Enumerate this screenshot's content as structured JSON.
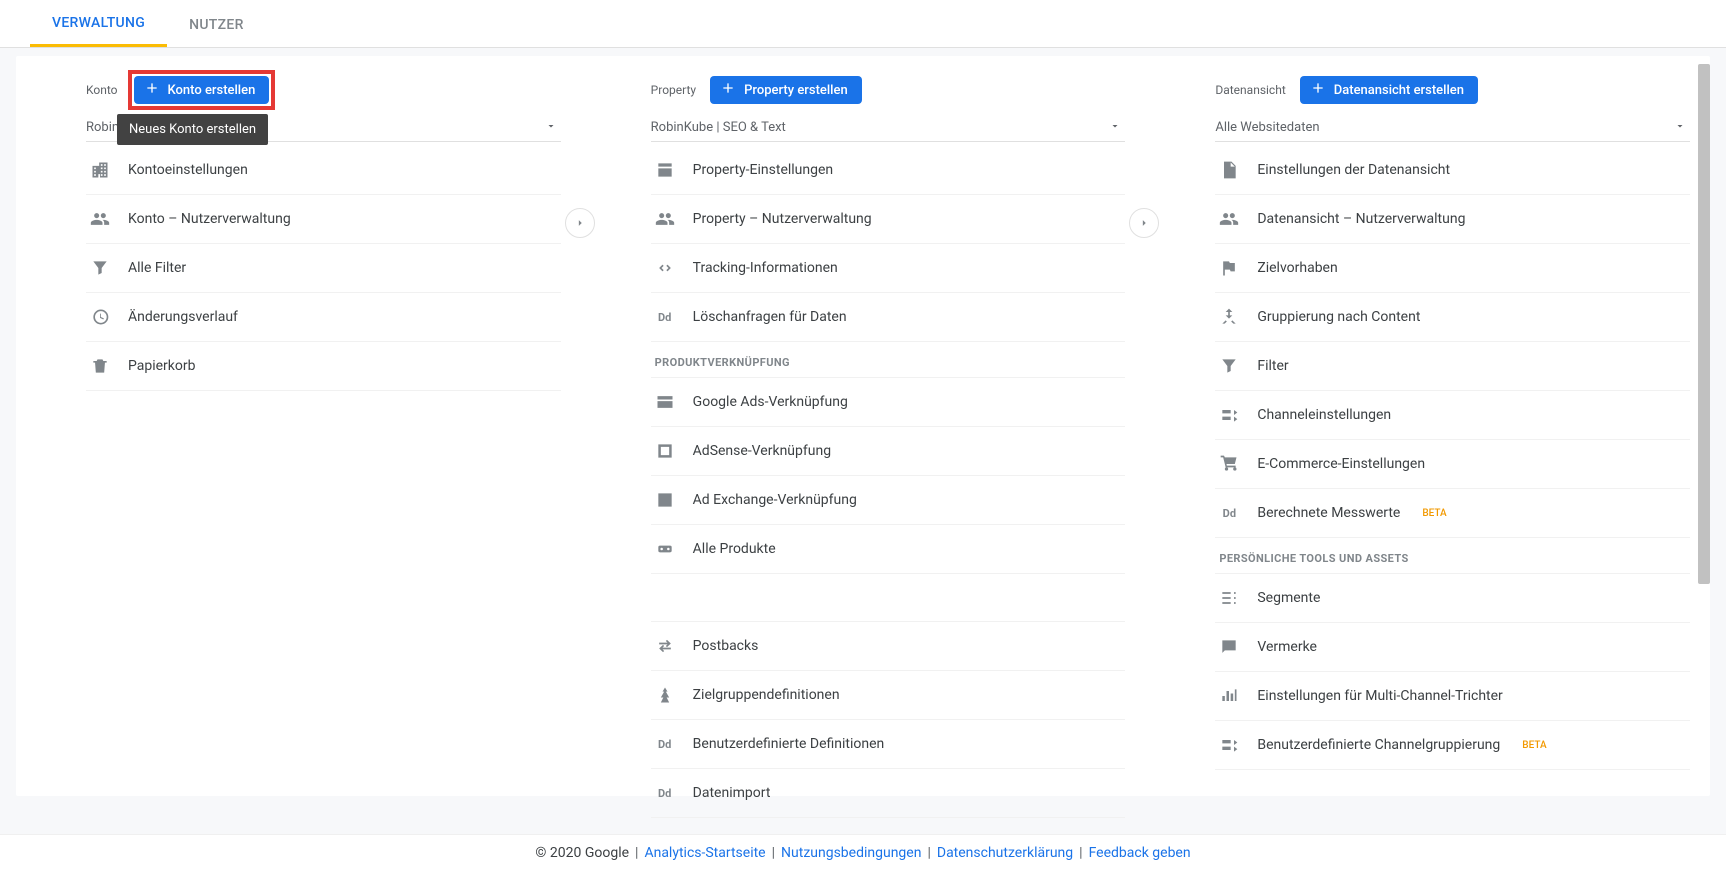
{
  "tabs": {
    "admin": "VERWALTUNG",
    "user": "NUTZER"
  },
  "tooltip": "Neues Konto erstellen",
  "columns": {
    "account": {
      "label": "Konto",
      "create_btn": "Konto erstellen",
      "selector": "RobinKu",
      "items": [
        {
          "label": "Kontoeinstellungen",
          "icon": "building"
        },
        {
          "label": "Konto – Nutzerverwaltung",
          "icon": "people"
        },
        {
          "label": "Alle Filter",
          "icon": "filter"
        },
        {
          "label": "Änderungsverlauf",
          "icon": "history"
        },
        {
          "label": "Papierkorb",
          "icon": "trash"
        }
      ]
    },
    "property": {
      "label": "Property",
      "create_btn": "Property erstellen",
      "selector": "RobinKube | SEO & Text",
      "items1": [
        {
          "label": "Property-Einstellungen",
          "icon": "settings-box"
        },
        {
          "label": "Property – Nutzerverwaltung",
          "icon": "people"
        },
        {
          "label": "Tracking-Informationen",
          "icon": "code"
        },
        {
          "label": "Löschanfragen für Daten",
          "icon": "dd"
        }
      ],
      "section1": "PRODUKTVERKNÜPFUNG",
      "items2": [
        {
          "label": "Google Ads-Verknüpfung",
          "icon": "ads"
        },
        {
          "label": "AdSense-Verknüpfung",
          "icon": "adsense"
        },
        {
          "label": "Ad Exchange-Verknüpfung",
          "icon": "adx"
        },
        {
          "label": "Alle Produkte",
          "icon": "products"
        }
      ],
      "items3": [
        {
          "label": "Postbacks",
          "icon": "postbacks"
        },
        {
          "label": "Zielgruppendefinitionen",
          "icon": "audience"
        },
        {
          "label": "Benutzerdefinierte Definitionen",
          "icon": "dd"
        },
        {
          "label": "Datenimport",
          "icon": "dd"
        }
      ]
    },
    "view": {
      "label": "Datenansicht",
      "create_btn": "Datenansicht erstellen",
      "selector": "Alle Websitedaten",
      "items1": [
        {
          "label": "Einstellungen der Datenansicht",
          "icon": "page"
        },
        {
          "label": "Datenansicht – Nutzerverwaltung",
          "icon": "people"
        },
        {
          "label": "Zielvorhaben",
          "icon": "flag"
        },
        {
          "label": "Gruppierung nach Content",
          "icon": "person-merge"
        },
        {
          "label": "Filter",
          "icon": "filter"
        },
        {
          "label": "Channeleinstellungen",
          "icon": "channel"
        },
        {
          "label": "E-Commerce-Einstellungen",
          "icon": "cart"
        },
        {
          "label": "Berechnete Messwerte",
          "icon": "dd",
          "beta": "BETA"
        }
      ],
      "section1": "PERSÖNLICHE TOOLS UND ASSETS",
      "items2": [
        {
          "label": "Segmente",
          "icon": "segments"
        },
        {
          "label": "Vermerke",
          "icon": "annotation"
        },
        {
          "label": "Einstellungen für Multi-Channel-Trichter",
          "icon": "bars"
        },
        {
          "label": "Benutzerdefinierte Channelgruppierung",
          "icon": "channel",
          "beta": "BETA"
        }
      ]
    }
  },
  "footer": {
    "copyright": "© 2020 Google",
    "links": [
      "Analytics-Startseite",
      "Nutzungsbedingungen",
      "Datenschutzerklärung",
      "Feedback geben"
    ]
  }
}
